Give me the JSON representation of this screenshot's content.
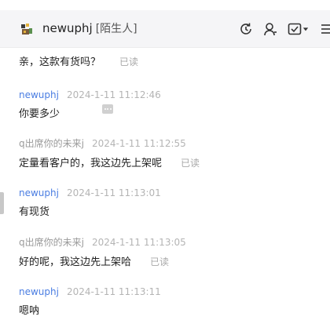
{
  "header": {
    "contact_name": "newuphj",
    "contact_tag": "[陌生人]",
    "icons": [
      "refresh-clock-icon",
      "user-icon",
      "task-check-icon",
      "chevron-down-icon",
      "menu-icon"
    ]
  },
  "messages": [
    {
      "sender": "newuphj",
      "time": "2024-1-11 11:12:46",
      "text": "你要多少",
      "status": "",
      "self": true
    },
    {
      "sender": "q出席你的未来j",
      "time": "2024-1-11 11:12:55",
      "text": "定量看客户的，我这边先上架呢",
      "status": "已读",
      "self": false
    },
    {
      "sender": "newuphj",
      "time": "2024-1-11 11:13:01",
      "text": "有现货",
      "status": "",
      "self": true
    },
    {
      "sender": "q出席你的未来j",
      "time": "2024-1-11 11:13:05",
      "text": "好的呢，我这边先上架哈",
      "status": "已读",
      "self": false
    },
    {
      "sender": "newuphj",
      "time": "2024-1-11 11:13:11",
      "text": "嗯呐",
      "status": "",
      "self": true
    }
  ],
  "partial_top_message": {
    "text": "亲，这款有货吗？",
    "status": "已读"
  },
  "colors": {
    "self_sender": "#4a7de2",
    "other_sender": "#9a9a9a",
    "timestamp": "#b4b4b4",
    "header_bg": "#f5f5f7"
  }
}
